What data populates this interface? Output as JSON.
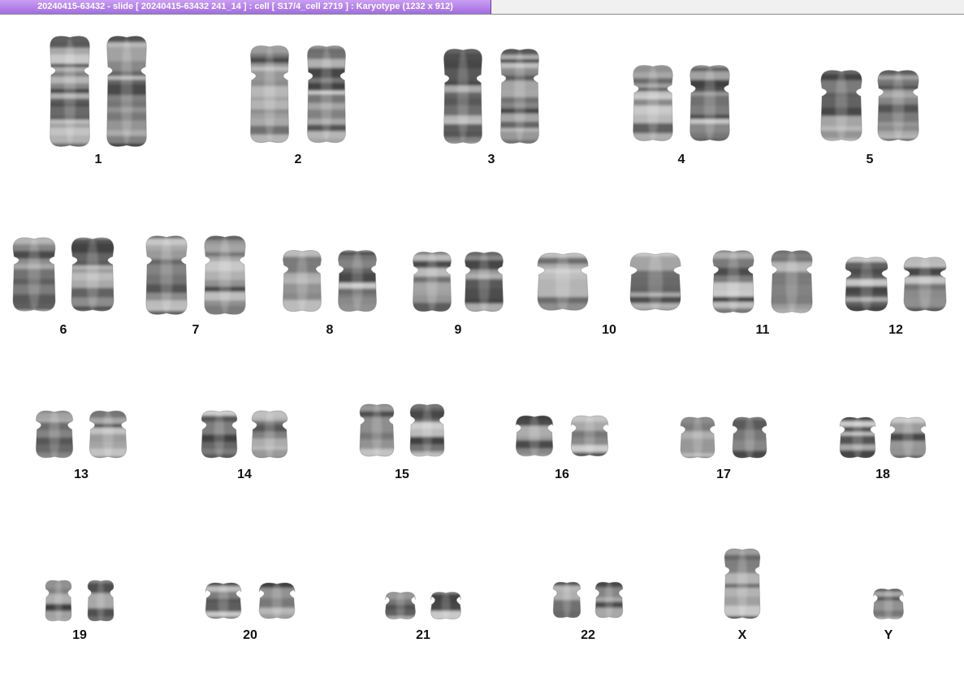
{
  "window": {
    "title": "20240415-63432 - slide [ 20240415-63432 241_14 ] : cell [ S17/4_cell 2719 ] : Karyotype  (1232 x 912)"
  },
  "karyotype": {
    "chromosomes": [
      {
        "label": "1",
        "count": 2
      },
      {
        "label": "2",
        "count": 2
      },
      {
        "label": "3",
        "count": 2
      },
      {
        "label": "4",
        "count": 2
      },
      {
        "label": "5",
        "count": 2
      },
      {
        "label": "6",
        "count": 2
      },
      {
        "label": "7",
        "count": 2
      },
      {
        "label": "8",
        "count": 2
      },
      {
        "label": "9",
        "count": 2
      },
      {
        "label": "10",
        "count": 2
      },
      {
        "label": "11",
        "count": 2
      },
      {
        "label": "12",
        "count": 2
      },
      {
        "label": "13",
        "count": 2
      },
      {
        "label": "14",
        "count": 2
      },
      {
        "label": "15",
        "count": 2
      },
      {
        "label": "16",
        "count": 2
      },
      {
        "label": "17",
        "count": 2
      },
      {
        "label": "18",
        "count": 2
      },
      {
        "label": "19",
        "count": 2
      },
      {
        "label": "20",
        "count": 2
      },
      {
        "label": "21",
        "count": 2
      },
      {
        "label": "22",
        "count": 2
      },
      {
        "label": "X",
        "count": 1
      },
      {
        "label": "Y",
        "count": 1
      }
    ]
  }
}
